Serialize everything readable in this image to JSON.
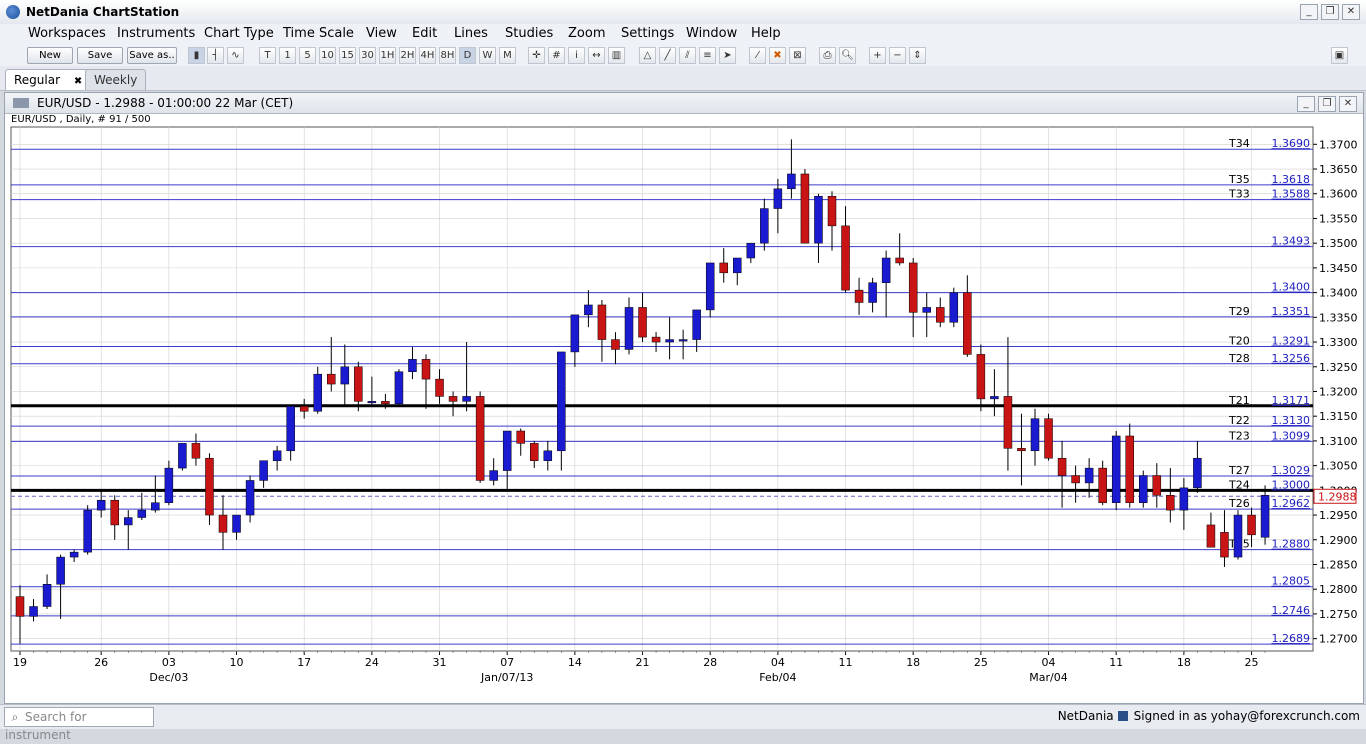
{
  "app": {
    "title": "NetDania ChartStation"
  },
  "menus": [
    "Workspaces",
    "Instruments",
    "Chart Type",
    "Time Scale",
    "View",
    "Edit",
    "Lines",
    "Studies",
    "Zoom",
    "Settings",
    "Window",
    "Help"
  ],
  "toolbar": {
    "new_label": "New",
    "save_label": "Save",
    "saveas_label": "Save as..",
    "timescales": [
      "T",
      "1",
      "5",
      "10",
      "15",
      "30",
      "1H",
      "2H",
      "4H",
      "8H",
      "D",
      "W",
      "M"
    ]
  },
  "tabs": [
    {
      "label": "Regular",
      "active": true,
      "close": "✖"
    },
    {
      "label": "Weekly",
      "active": false
    }
  ],
  "chart_window": {
    "title": "EUR/USD - 1.2988 - 01:00:00  22 Mar (CET)",
    "subtitle": "EUR/USD , Daily, # 91 / 500"
  },
  "chart_data": {
    "type": "candlestick",
    "y_range": [
      1.2675,
      1.3735
    ],
    "y_ticks": [
      "1.2700",
      "1.2750",
      "1.2800",
      "1.2850",
      "1.2900",
      "1.2950",
      "1.3000",
      "1.3050",
      "1.3100",
      "1.3150",
      "1.3200",
      "1.3250",
      "1.3300",
      "1.3350",
      "1.3400",
      "1.3450",
      "1.3500",
      "1.3550",
      "1.3600",
      "1.3650",
      "1.3700"
    ],
    "x_ticks": [
      "19",
      "26",
      "03",
      "10",
      "17",
      "24",
      "31",
      "07",
      "14",
      "21",
      "28",
      "04",
      "11",
      "18",
      "25",
      "04",
      "11",
      "18",
      "25"
    ],
    "x_tick_index": [
      0,
      6,
      11,
      16,
      21,
      26,
      31,
      36,
      41,
      46,
      51,
      56,
      61,
      66,
      71,
      76,
      81,
      86,
      91
    ],
    "month_labels": [
      {
        "label": "Dec/03",
        "at": 11
      },
      {
        "label": "Jan/07/13",
        "at": 36
      },
      {
        "label": "Feb/04",
        "at": 56
      },
      {
        "label": "Mar/04",
        "at": 76
      }
    ],
    "current_price": {
      "value": 1.2988,
      "label": "1.2988"
    },
    "colors": {
      "up": "#1a1ad0",
      "down": "#c81414",
      "level": "#3c3ccc",
      "thick": "#000000",
      "grid": "#d0d0d0",
      "current": "#6666cc"
    },
    "levels": [
      {
        "tag": "T34",
        "label": "1.3690",
        "value": 1.369,
        "thick": false
      },
      {
        "tag": "T35",
        "label": "1.3618",
        "value": 1.3618,
        "thick": false
      },
      {
        "tag": "T33",
        "label": "1.3588",
        "value": 1.3588,
        "thick": false
      },
      {
        "tag": "",
        "label": "1.3493",
        "value": 1.3493,
        "thick": false
      },
      {
        "tag": "",
        "label": "1.3400",
        "value": 1.34,
        "thick": false
      },
      {
        "tag": "T29",
        "label": "1.3351",
        "value": 1.3351,
        "thick": false
      },
      {
        "tag": "T20",
        "label": "1.3291",
        "value": 1.3291,
        "thick": false
      },
      {
        "tag": "T28",
        "label": "1.3256",
        "value": 1.3256,
        "thick": false
      },
      {
        "tag": "T21",
        "label": "1.3171",
        "value": 1.3171,
        "thick": true
      },
      {
        "tag": "T22",
        "label": "1.3130",
        "value": 1.313,
        "thick": false
      },
      {
        "tag": "T23",
        "label": "1.3099",
        "value": 1.3099,
        "thick": false
      },
      {
        "tag": "T27",
        "label": "1.3029",
        "value": 1.3029,
        "thick": false
      },
      {
        "tag": "T24",
        "label": "1.3000",
        "value": 1.3,
        "thick": true
      },
      {
        "tag": "T26",
        "label": "1.2962",
        "value": 1.2962,
        "thick": false
      },
      {
        "tag": "T25",
        "label": "1.2880",
        "value": 1.288,
        "thick": false
      },
      {
        "tag": "",
        "label": "1.2805",
        "value": 1.2805,
        "thick": false
      },
      {
        "tag": "",
        "label": "1.2746",
        "value": 1.2746,
        "thick": false
      },
      {
        "tag": "",
        "label": "1.2689",
        "value": 1.2689,
        "thick": false
      }
    ],
    "candles": [
      [
        1.2785,
        1.2808,
        1.269,
        1.2745
      ],
      [
        1.2745,
        1.278,
        1.2735,
        1.2765
      ],
      [
        1.2765,
        1.283,
        1.276,
        1.281
      ],
      [
        1.281,
        1.287,
        1.274,
        1.2865
      ],
      [
        1.2865,
        1.288,
        1.2855,
        1.2875
      ],
      [
        1.2875,
        1.297,
        1.287,
        1.296
      ],
      [
        1.296,
        1.3,
        1.2945,
        1.298
      ],
      [
        1.298,
        1.299,
        1.29,
        1.293
      ],
      [
        1.293,
        1.296,
        1.288,
        1.2945
      ],
      [
        1.2945,
        1.2995,
        1.294,
        1.296
      ],
      [
        1.296,
        1.303,
        1.2955,
        1.2975
      ],
      [
        1.2975,
        1.306,
        1.297,
        1.3045
      ],
      [
        1.3045,
        1.3095,
        1.304,
        1.3095
      ],
      [
        1.3095,
        1.3115,
        1.305,
        1.3065
      ],
      [
        1.3065,
        1.3075,
        1.293,
        1.295
      ],
      [
        1.295,
        1.299,
        1.288,
        1.2915
      ],
      [
        1.2915,
        1.295,
        1.29,
        1.295
      ],
      [
        1.295,
        1.303,
        1.2935,
        1.302
      ],
      [
        1.302,
        1.306,
        1.3005,
        1.306
      ],
      [
        1.306,
        1.309,
        1.304,
        1.308
      ],
      [
        1.308,
        1.317,
        1.306,
        1.317
      ],
      [
        1.317,
        1.3185,
        1.3145,
        1.316
      ],
      [
        1.316,
        1.325,
        1.3155,
        1.3235
      ],
      [
        1.3235,
        1.331,
        1.32,
        1.3215
      ],
      [
        1.3215,
        1.3295,
        1.317,
        1.325
      ],
      [
        1.325,
        1.326,
        1.316,
        1.318
      ],
      [
        1.318,
        1.323,
        1.317,
        1.318
      ],
      [
        1.318,
        1.3195,
        1.3165,
        1.3175
      ],
      [
        1.3175,
        1.3245,
        1.317,
        1.324
      ],
      [
        1.324,
        1.329,
        1.3225,
        1.3265
      ],
      [
        1.3265,
        1.3275,
        1.3165,
        1.3225
      ],
      [
        1.3225,
        1.3245,
        1.3175,
        1.319
      ],
      [
        1.319,
        1.32,
        1.315,
        1.318
      ],
      [
        1.318,
        1.33,
        1.316,
        1.319
      ],
      [
        1.319,
        1.32,
        1.3015,
        1.302
      ],
      [
        1.302,
        1.3065,
        1.301,
        1.304
      ],
      [
        1.304,
        1.311,
        1.3,
        1.312
      ],
      [
        1.312,
        1.3125,
        1.307,
        1.3095
      ],
      [
        1.3095,
        1.31,
        1.3045,
        1.306
      ],
      [
        1.306,
        1.31,
        1.304,
        1.308
      ],
      [
        1.308,
        1.328,
        1.304,
        1.328
      ],
      [
        1.328,
        1.334,
        1.325,
        1.3355
      ],
      [
        1.3355,
        1.3405,
        1.333,
        1.3375
      ],
      [
        1.3375,
        1.3385,
        1.326,
        1.3305
      ],
      [
        1.3305,
        1.332,
        1.3255,
        1.3285
      ],
      [
        1.3285,
        1.339,
        1.3275,
        1.337
      ],
      [
        1.337,
        1.34,
        1.33,
        1.331
      ],
      [
        1.331,
        1.332,
        1.328,
        1.33
      ],
      [
        1.33,
        1.335,
        1.3265,
        1.3305
      ],
      [
        1.3305,
        1.3325,
        1.3265,
        1.3305
      ],
      [
        1.3305,
        1.3365,
        1.328,
        1.3365
      ],
      [
        1.3365,
        1.346,
        1.335,
        1.346
      ],
      [
        1.346,
        1.349,
        1.342,
        1.344
      ],
      [
        1.344,
        1.347,
        1.3415,
        1.347
      ],
      [
        1.347,
        1.35,
        1.346,
        1.35
      ],
      [
        1.35,
        1.359,
        1.3485,
        1.357
      ],
      [
        1.357,
        1.363,
        1.352,
        1.361
      ],
      [
        1.361,
        1.371,
        1.359,
        1.364
      ],
      [
        1.364,
        1.365,
        1.35,
        1.35
      ],
      [
        1.35,
        1.36,
        1.346,
        1.3595
      ],
      [
        1.3595,
        1.3605,
        1.3485,
        1.3535
      ],
      [
        1.3535,
        1.3575,
        1.34,
        1.3405
      ],
      [
        1.3405,
        1.343,
        1.3355,
        1.338
      ],
      [
        1.338,
        1.343,
        1.336,
        1.342
      ],
      [
        1.342,
        1.3485,
        1.335,
        1.347
      ],
      [
        1.347,
        1.352,
        1.3455,
        1.346
      ],
      [
        1.346,
        1.347,
        1.331,
        1.336
      ],
      [
        1.336,
        1.34,
        1.331,
        1.337
      ],
      [
        1.337,
        1.339,
        1.333,
        1.334
      ],
      [
        1.334,
        1.341,
        1.333,
        1.34
      ],
      [
        1.34,
        1.3435,
        1.327,
        1.3275
      ],
      [
        1.3275,
        1.3295,
        1.316,
        1.3185
      ],
      [
        1.3185,
        1.3245,
        1.315,
        1.319
      ],
      [
        1.319,
        1.331,
        1.304,
        1.3085
      ],
      [
        1.3085,
        1.3155,
        1.301,
        1.308
      ],
      [
        1.308,
        1.3165,
        1.305,
        1.3145
      ],
      [
        1.3145,
        1.3155,
        1.306,
        1.3065
      ],
      [
        1.3065,
        1.31,
        1.2965,
        1.303
      ],
      [
        1.303,
        1.305,
        1.2975,
        1.3015
      ],
      [
        1.3015,
        1.3065,
        1.2985,
        1.3045
      ],
      [
        1.3045,
        1.306,
        1.297,
        1.2975
      ],
      [
        1.2975,
        1.312,
        1.296,
        1.311
      ],
      [
        1.311,
        1.3135,
        1.2965,
        1.2975
      ],
      [
        1.2975,
        1.304,
        1.2965,
        1.303
      ],
      [
        1.303,
        1.3055,
        1.2965,
        1.299
      ],
      [
        1.299,
        1.3045,
        1.2935,
        1.296
      ],
      [
        1.296,
        1.3025,
        1.292,
        1.3005
      ],
      [
        1.3005,
        1.31,
        1.2995,
        1.3065
      ],
      [
        1.293,
        1.2955,
        1.2885,
        1.2885
      ],
      [
        1.2915,
        1.296,
        1.2845,
        1.2865
      ],
      [
        1.2865,
        1.296,
        1.286,
        1.295
      ],
      [
        1.295,
        1.2965,
        1.2885,
        1.291
      ],
      [
        1.2905,
        1.301,
        1.289,
        1.299
      ]
    ]
  },
  "status": {
    "search_placeholder": "Search for instrument",
    "brand": "NetDania",
    "signed_in": "Signed in as yohay@forexcrunch.com"
  }
}
